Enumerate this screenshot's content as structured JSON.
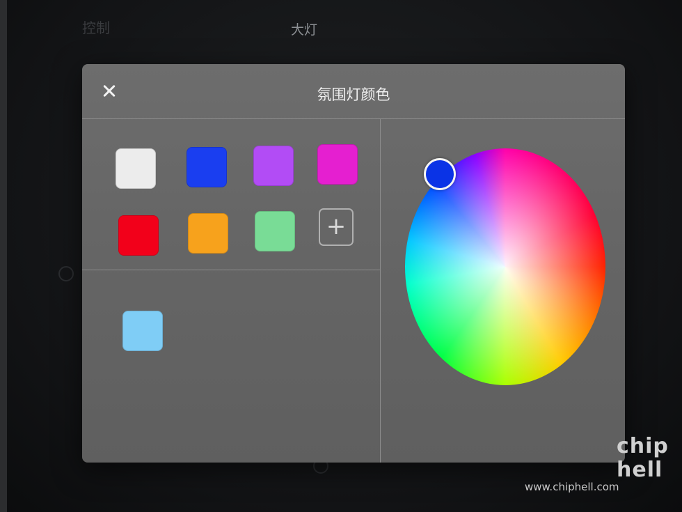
{
  "background": {
    "tab_control": "控制",
    "tab_lights": "大灯"
  },
  "dialog": {
    "title": "氛围灯颜色",
    "close_icon": "close-icon",
    "presets": [
      {
        "name": "white",
        "color": "#ececec"
      },
      {
        "name": "blue",
        "color": "#1a3ef0"
      },
      {
        "name": "purple",
        "color": "#b24cf5"
      },
      {
        "name": "magenta",
        "color": "#e51fd0"
      },
      {
        "name": "red",
        "color": "#f2001a"
      },
      {
        "name": "orange",
        "color": "#f7a21c"
      },
      {
        "name": "green",
        "color": "#79dc96"
      }
    ],
    "add_label": "+",
    "custom_swatches": [
      {
        "name": "light-blue",
        "color": "#7fcdf6"
      }
    ],
    "color_wheel": {
      "selected_color": "#0a33e6"
    }
  },
  "watermark": {
    "logo_top": "chip",
    "logo_bottom": "hell",
    "url": "www.chiphell.com"
  }
}
